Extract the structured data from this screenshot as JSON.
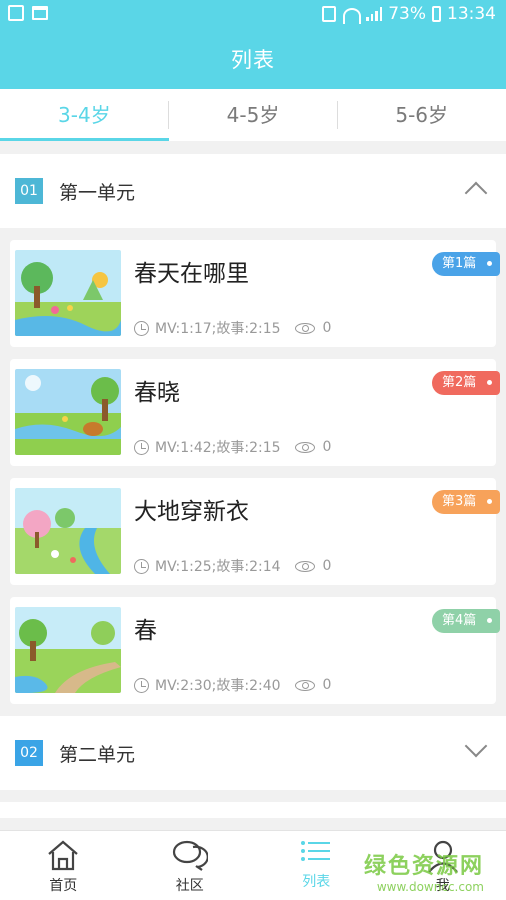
{
  "status_bar": {
    "battery": "73%",
    "time": "13:34"
  },
  "header": {
    "title": "列表"
  },
  "tabs": [
    {
      "label": "3-4岁",
      "active": true
    },
    {
      "label": "4-5岁",
      "active": false
    },
    {
      "label": "5-6岁",
      "active": false
    }
  ],
  "units": [
    {
      "number": "01",
      "title": "第一单元",
      "expanded": true,
      "lessons": [
        {
          "title": "春天在哪里",
          "duration": "MV:1:17;故事:2:15",
          "views": "0",
          "badge": "第1篇",
          "badge_color": "#4aa3e8"
        },
        {
          "title": "春晓",
          "duration": "MV:1:42;故事:2:15",
          "views": "0",
          "badge": "第2篇",
          "badge_color": "#f06a5e"
        },
        {
          "title": "大地穿新衣",
          "duration": "MV:1:25;故事:2:14",
          "views": "0",
          "badge": "第3篇",
          "badge_color": "#f7a25a"
        },
        {
          "title": "春",
          "duration": "MV:2:30;故事:2:40",
          "views": "0",
          "badge": "第4篇",
          "badge_color": "#8fd1a8"
        }
      ]
    },
    {
      "number": "02",
      "title": "第二单元",
      "expanded": false,
      "lessons": []
    }
  ],
  "bottom_nav": [
    {
      "label": "首页",
      "icon": "home-icon",
      "active": false
    },
    {
      "label": "社区",
      "icon": "chat-icon",
      "active": false
    },
    {
      "label": "列表",
      "icon": "list-icon",
      "active": true
    },
    {
      "label": "我",
      "icon": "user-icon",
      "active": false
    }
  ],
  "watermark": {
    "line1": "绿色资源网",
    "line2": "www.downcc.com"
  },
  "colors": {
    "accent": "#5ad6e7"
  }
}
